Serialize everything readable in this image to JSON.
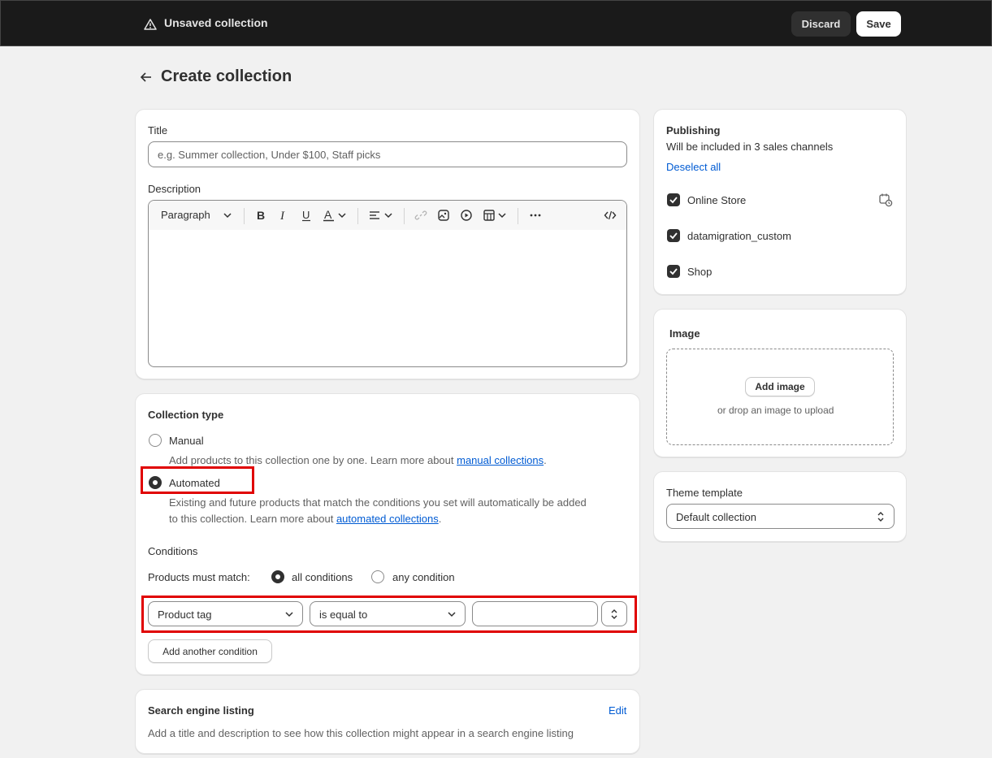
{
  "topbar": {
    "title": "Unsaved collection",
    "discard_label": "Discard",
    "save_label": "Save"
  },
  "page": {
    "title": "Create collection"
  },
  "main_card": {
    "title_label": "Title",
    "title_placeholder": "e.g. Summer collection, Under $100, Staff picks",
    "description_label": "Description",
    "toolbar": {
      "paragraph_label": "Paragraph"
    }
  },
  "collection_type": {
    "heading": "Collection type",
    "manual_label": "Manual",
    "manual_desc": "Add products to this collection one by one. Learn more about ",
    "manual_link": "manual collections",
    "manual_period": ".",
    "automated_label": "Automated",
    "automated_desc_line1": "Existing and future products that match the conditions you set will automatically be added",
    "automated_desc_line2": "to this collection. Learn more about ",
    "automated_link": "automated collections",
    "automated_period": ".",
    "selected": "Automated",
    "conditions_heading": "Conditions",
    "match_label": "Products must match:",
    "match_all": "all conditions",
    "match_any": "any condition",
    "match_selected": "all conditions",
    "condition": {
      "field": "Product tag",
      "operator": "is equal to",
      "value": ""
    },
    "add_condition_label": "Add another condition"
  },
  "seo": {
    "heading": "Search engine listing",
    "edit_label": "Edit",
    "desc": "Add a title and description to see how this collection might appear in a search engine listing"
  },
  "publishing": {
    "heading": "Publishing",
    "subtitle": "Will be included in 3 sales channels",
    "deselect_label": "Deselect all",
    "channels": [
      {
        "label": "Online Store",
        "checked": true
      },
      {
        "label": "datamigration_custom",
        "checked": true
      },
      {
        "label": "Shop",
        "checked": true
      }
    ]
  },
  "image": {
    "heading": "Image",
    "add_label": "Add image",
    "drop_hint": "or drop an image to upload"
  },
  "theme": {
    "heading": "Theme template",
    "selected": "Default collection"
  },
  "colors": {
    "topbar_bg": "#1a1a1a",
    "link": "#005bd3",
    "highlight": "#e00000",
    "page_bg": "#f1f1f1"
  }
}
